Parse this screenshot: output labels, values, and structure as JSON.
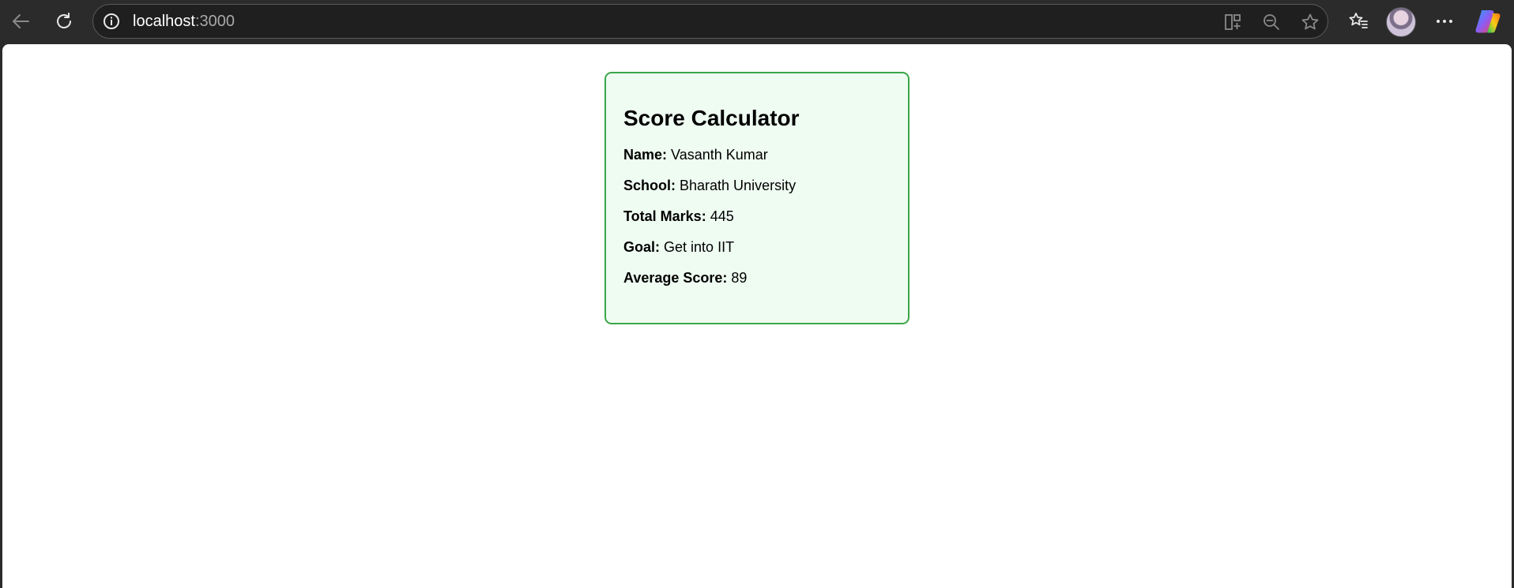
{
  "browser": {
    "url_host": "localhost",
    "url_port": ":3000"
  },
  "card": {
    "title": "Score Calculator",
    "rows": [
      {
        "label": "Name:",
        "value": "Vasanth Kumar"
      },
      {
        "label": "School:",
        "value": "Bharath University"
      },
      {
        "label": "Total Marks:",
        "value": "445"
      },
      {
        "label": "Goal:",
        "value": "Get into IIT"
      },
      {
        "label": "Average Score:",
        "value": "89"
      }
    ]
  },
  "colors": {
    "card_background": "#effcf2",
    "card_border": "#3aa64a",
    "browser_chrome": "#2b2b2b"
  },
  "icons": [
    "back-arrow-icon",
    "refresh-icon",
    "info-icon",
    "split-screen-icon",
    "zoom-out-icon",
    "star-icon",
    "favorites-icon",
    "more-icon",
    "copilot-icon"
  ]
}
